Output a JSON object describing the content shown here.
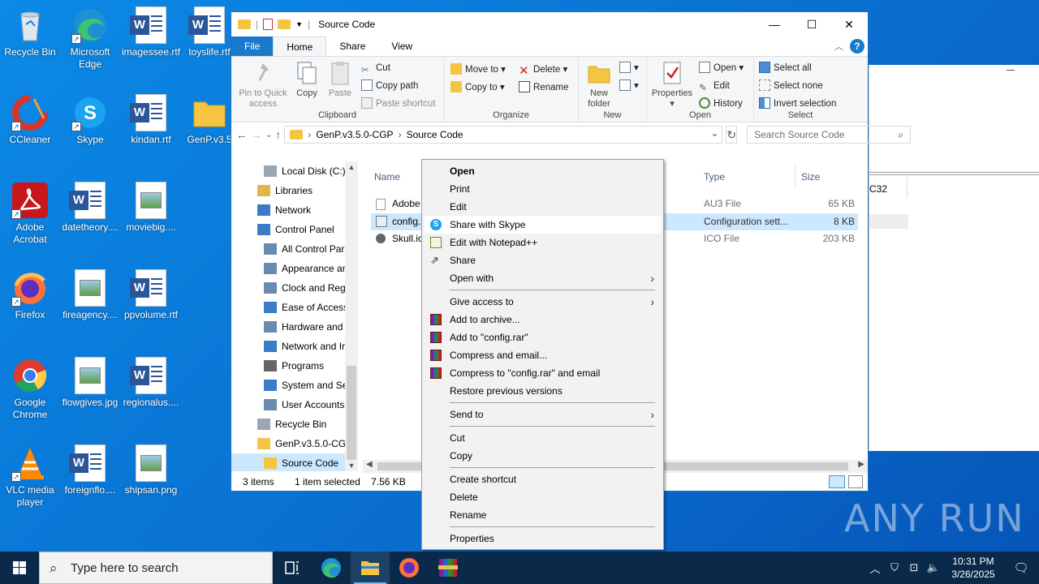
{
  "desktop": {
    "icons": [
      {
        "label": "Recycle Bin"
      },
      {
        "label": "Microsoft Edge"
      },
      {
        "label": "imagessee.rtf"
      },
      {
        "label": "toyslife.rtf"
      },
      {
        "label": "CCleaner"
      },
      {
        "label": "Skype"
      },
      {
        "label": "kindan.rtf"
      },
      {
        "label": "GenP.v3.5"
      },
      {
        "label": "Adobe Acrobat"
      },
      {
        "label": "datetheory...."
      },
      {
        "label": "moviebig...."
      },
      {
        "label": "Firefox"
      },
      {
        "label": "fireagency...."
      },
      {
        "label": "ppvolume.rtf"
      },
      {
        "label": "Google Chrome"
      },
      {
        "label": "flowgives.jpg"
      },
      {
        "label": "regionalus...."
      },
      {
        "label": "VLC media player"
      },
      {
        "label": "foreignflo...."
      },
      {
        "label": "shipsan.png"
      }
    ],
    "watermark": "ANY RUN"
  },
  "explorer": {
    "title": "Source Code",
    "tabs": [
      "File",
      "Home",
      "Share",
      "View"
    ],
    "ribbon": {
      "clipboard": {
        "label": "Clipboard",
        "pin": "Pin to Quick access",
        "copy": "Copy",
        "paste": "Paste",
        "cut": "Cut",
        "copy_path": "Copy path",
        "paste_shortcut": "Paste shortcut"
      },
      "organize": {
        "label": "Organize",
        "move_to": "Move to",
        "copy_to": "Copy to",
        "delete": "Delete",
        "rename": "Rename"
      },
      "new": {
        "label": "New",
        "new_folder": "New folder"
      },
      "open": {
        "label": "Open",
        "properties": "Properties",
        "open": "Open",
        "edit": "Edit",
        "history": "History"
      },
      "select": {
        "label": "Select",
        "select_all": "Select all",
        "select_none": "Select none",
        "invert": "Invert selection"
      }
    },
    "address": {
      "crumbs": [
        "GenP.v3.5.0-CGP",
        "Source Code"
      ]
    },
    "search_placeholder": "Search Source Code",
    "nav": [
      {
        "label": "Local Disk (C:)",
        "indent": 1
      },
      {
        "label": "Libraries",
        "indent": 0
      },
      {
        "label": "Network",
        "indent": 0
      },
      {
        "label": "Control Panel",
        "indent": 0
      },
      {
        "label": "All Control Par",
        "indent": 1
      },
      {
        "label": "Appearance an",
        "indent": 1
      },
      {
        "label": "Clock and Regi",
        "indent": 1
      },
      {
        "label": "Ease of Access",
        "indent": 1
      },
      {
        "label": "Hardware and",
        "indent": 1
      },
      {
        "label": "Network and Ir",
        "indent": 1
      },
      {
        "label": "Programs",
        "indent": 1
      },
      {
        "label": "System and Sec",
        "indent": 1
      },
      {
        "label": "User Accounts",
        "indent": 1
      },
      {
        "label": "Recycle Bin",
        "indent": 0
      },
      {
        "label": "GenP.v3.5.0-CGP",
        "indent": 0
      },
      {
        "label": "Source Code",
        "indent": 1
      }
    ],
    "columns": {
      "name": "Name",
      "type": "Type",
      "size": "Size"
    },
    "files": [
      {
        "name": "Adobe",
        "type": "AU3 File",
        "size": "65 KB"
      },
      {
        "name": "config.",
        "type": "Configuration sett...",
        "size": "8 KB"
      },
      {
        "name": "Skull.ic",
        "type": "ICO File",
        "size": "203 KB"
      }
    ],
    "status": {
      "count": "3 items",
      "selected": "1 item selected",
      "size": "7.56 KB"
    }
  },
  "background_window": {
    "text": "C32"
  },
  "context_menu": {
    "items": [
      "Open",
      "Print",
      "Edit",
      "Share with Skype",
      "Edit with Notepad++",
      "Share",
      "Open with",
      "Give access to",
      "Add to archive...",
      "Add to \"config.rar\"",
      "Compress and email...",
      "Compress to \"config.rar\" and email",
      "Restore previous versions",
      "Send to",
      "Cut",
      "Copy",
      "Create shortcut",
      "Delete",
      "Rename",
      "Properties"
    ]
  },
  "taskbar": {
    "search_placeholder": "Type here to search",
    "time": "10:31 PM",
    "date": "3/26/2025"
  }
}
